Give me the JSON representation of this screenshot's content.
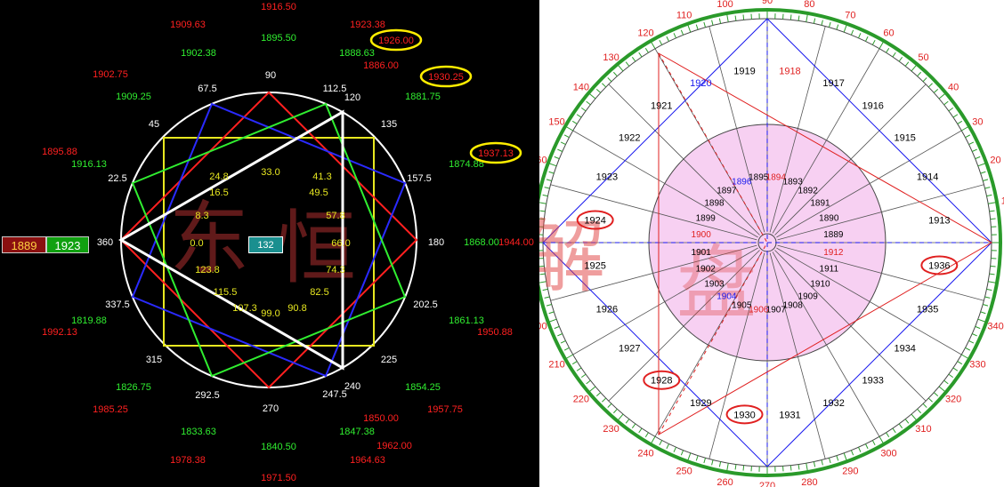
{
  "left": {
    "colors": {
      "red": "#ff2020",
      "green": "#30ee30",
      "blue": "#2a2aff",
      "yellow": "#e8e820",
      "white": "#ffffff",
      "highlight": "#ffee00",
      "teal": "#1a8f8f"
    },
    "red_numbers": [
      "1916.50",
      "1909.63",
      "1923.38",
      "1886.00",
      "1902.75",
      "1895.88",
      "1992.13",
      "1985.25",
      "1978.38",
      "1971.50",
      "1964.63",
      "1962.00",
      "1957.75",
      "1950.88",
      "1944.00",
      "1850.00"
    ],
    "green_numbers": [
      "1895.50",
      "1902.38",
      "1888.63",
      "1909.25",
      "1881.75",
      "1916.13",
      "1874.88",
      "1868.00",
      "1819.88",
      "1861.13",
      "1826.75",
      "1854.25",
      "1833.63",
      "1847.38",
      "1840.50"
    ],
    "highlighted": [
      "1926.00",
      "1930.25",
      "1937.13"
    ],
    "angles": [
      "90",
      "67.5",
      "112.5",
      "120",
      "45",
      "135",
      "22.5",
      "157.5",
      "360",
      "180",
      "337.5",
      "202.5",
      "315",
      "225",
      "292.5",
      "240",
      "247.5",
      "270"
    ],
    "inner_values": [
      "33.0",
      "24.8",
      "41.3",
      "16.5",
      "49.5",
      "8.3",
      "57.8",
      "0.0",
      "66.0",
      "123.8",
      "74.3",
      "115.5",
      "82.5",
      "107.3",
      "99.0",
      "90.8"
    ],
    "center_box": "132",
    "left_box_red": "1889",
    "left_box_green": "1923"
  },
  "right": {
    "outer_ticks": [
      "90",
      "100",
      "80",
      "110",
      "70",
      "120",
      "60",
      "130",
      "50",
      "140",
      "40",
      "150",
      "30",
      "160",
      "20",
      "170",
      "10",
      "180",
      "340",
      "190",
      "330",
      "200",
      "320",
      "210",
      "310",
      "220",
      "300",
      "230",
      "290",
      "240",
      "280",
      "250",
      "270",
      "260"
    ],
    "outer_years": [
      "1919",
      "1918",
      "1920",
      "1917",
      "1921",
      "1916",
      "1922",
      "1915",
      "1923",
      "1914",
      "1924",
      "1913",
      "1925",
      "1936",
      "1926",
      "1935",
      "1927",
      "1934",
      "1928",
      "1933",
      "1929",
      "1932",
      "1930",
      "1931"
    ],
    "inner_years": [
      "1895",
      "1894",
      "1896",
      "1893",
      "1897",
      "1892",
      "1898",
      "1891",
      "1899",
      "1890",
      "1900",
      "1889",
      "1901",
      "1912",
      "1902",
      "1911",
      "1903",
      "1910",
      "1904",
      "1909",
      "1905",
      "1908",
      "1906",
      "1907"
    ],
    "circled": [
      "1924",
      "1936",
      "1928",
      "1930"
    ],
    "blue_years": [
      "1920",
      "1896",
      "1904"
    ],
    "red_years": [
      "1918",
      "1894",
      "1900",
      "1912",
      "1906"
    ],
    "colors": {
      "red": "#e02020",
      "blue": "#1a1aee",
      "green": "#2a9a2a",
      "pink": "#f7d0f2"
    }
  },
  "watermark": "东 恒 解 盘"
}
